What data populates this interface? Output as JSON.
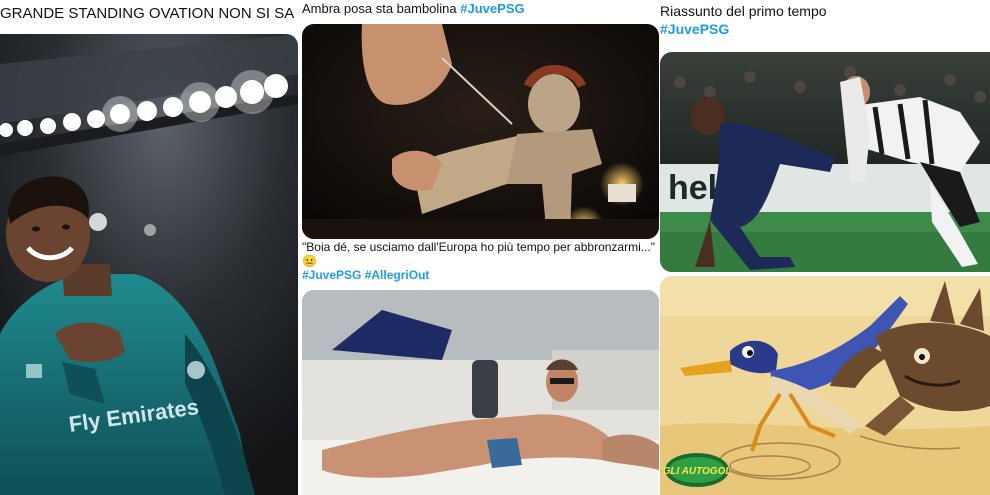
{
  "tweets": [
    {
      "caption": "GRANDE STANDING OVATION NON SI SA MAI",
      "emoji": "👏",
      "image_desc": "player-applauding-photo"
    },
    {
      "caption": "Ambra posa sta bambolina",
      "hashtags": [
        "#JuvePSG"
      ],
      "image_desc": "voodoo-doll-photo"
    },
    {
      "caption": "\"Boia dé, se usciamo dall'Europa ho più tempo per abbronzarmi...\"",
      "emoji": "😐",
      "hashtags": [
        "#JuvePSG",
        "#AllegriOut"
      ],
      "image_desc": "man-sunbathing-on-boat-photo"
    },
    {
      "caption": "Riassunto del primo tempo",
      "hashtags": [
        "#JuvePSG"
      ],
      "image_desc": "football-match-photo"
    },
    {
      "caption": "",
      "image_desc": "roadrunner-coyote-cartoon",
      "watermark": "GLI AUTOGOL"
    }
  ],
  "colors": {
    "hashtag": "#1d9bf0",
    "text": "#0f1419"
  }
}
